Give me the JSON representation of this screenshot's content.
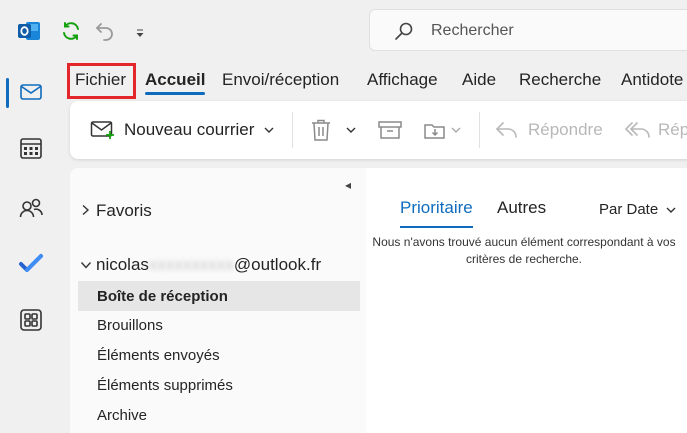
{
  "quick_access": {
    "app_icon": "outlook-logo-icon",
    "sync_icon": "sync-icon",
    "undo_icon": "undo-icon",
    "more_icon": "chevron-down-icon"
  },
  "search": {
    "placeholder": "Rechercher"
  },
  "rail": {
    "items": [
      "mail-icon",
      "calendar-icon",
      "people-icon",
      "todo-icon",
      "apps-icon"
    ],
    "active": "mail-icon"
  },
  "menu": {
    "tabs": [
      "Fichier",
      "Accueil",
      "Envoi/réception",
      "Affichage",
      "Aide",
      "Recherche",
      "Antidote"
    ],
    "active_tab": "Accueil",
    "highlighted_tab": "Fichier"
  },
  "ribbon": {
    "new_mail": "Nouveau courrier",
    "reply": "Répondre",
    "reply_all": "Rép"
  },
  "folders": {
    "favorites": "Favoris",
    "account_prefix": "nicolas",
    "account_hidden": "xxxxxxxxxx",
    "account_suffix": "@outlook.fr",
    "items": [
      "Boîte de réception",
      "Brouillons",
      "Éléments envoyés",
      "Éléments supprimés",
      "Archive"
    ],
    "selected": "Boîte de réception"
  },
  "message_list": {
    "tab_focused": "Prioritaire",
    "tab_other": "Autres",
    "sort_label": "Par Date",
    "empty_line1": "Nous n'avons trouvé aucun élément correspondant à vos",
    "empty_line2": "critères de recherche."
  },
  "colors": {
    "accent": "#0f6cbd",
    "highlight_box": "#e3262b",
    "sync_green": "#13a10e"
  }
}
